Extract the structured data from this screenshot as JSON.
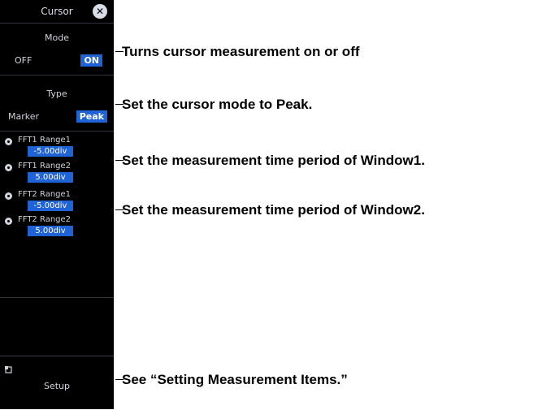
{
  "panel": {
    "title": "Cursor",
    "mode": {
      "label": "Mode",
      "options": [
        "OFF",
        "ON"
      ],
      "selected": "ON"
    },
    "type": {
      "label": "Type",
      "options": [
        "Marker",
        "Peak"
      ],
      "selected": "Peak"
    },
    "ranges": [
      {
        "label": "FFT1 Range1",
        "value": "-5.00div"
      },
      {
        "label": "FFT1 Range2",
        "value": "5.00div"
      },
      {
        "label": "FFT2 Range1",
        "value": "-5.00div"
      },
      {
        "label": "FFT2 Range2",
        "value": "5.00div"
      }
    ],
    "setup_label": "Setup"
  },
  "annotations": {
    "mode": "Turns cursor measurement on or off",
    "type": "Set the cursor mode to Peak.",
    "window1": "Set the measurement time period of Window1.",
    "window2": "Set the measurement time period of Window2.",
    "setup": "See “Setting Measurement Items.”"
  },
  "colors": {
    "selected": "#1f63d6",
    "panel_bg": "#000000"
  },
  "icons": [
    "close-icon",
    "radio-icon",
    "setup-menu-icon"
  ]
}
